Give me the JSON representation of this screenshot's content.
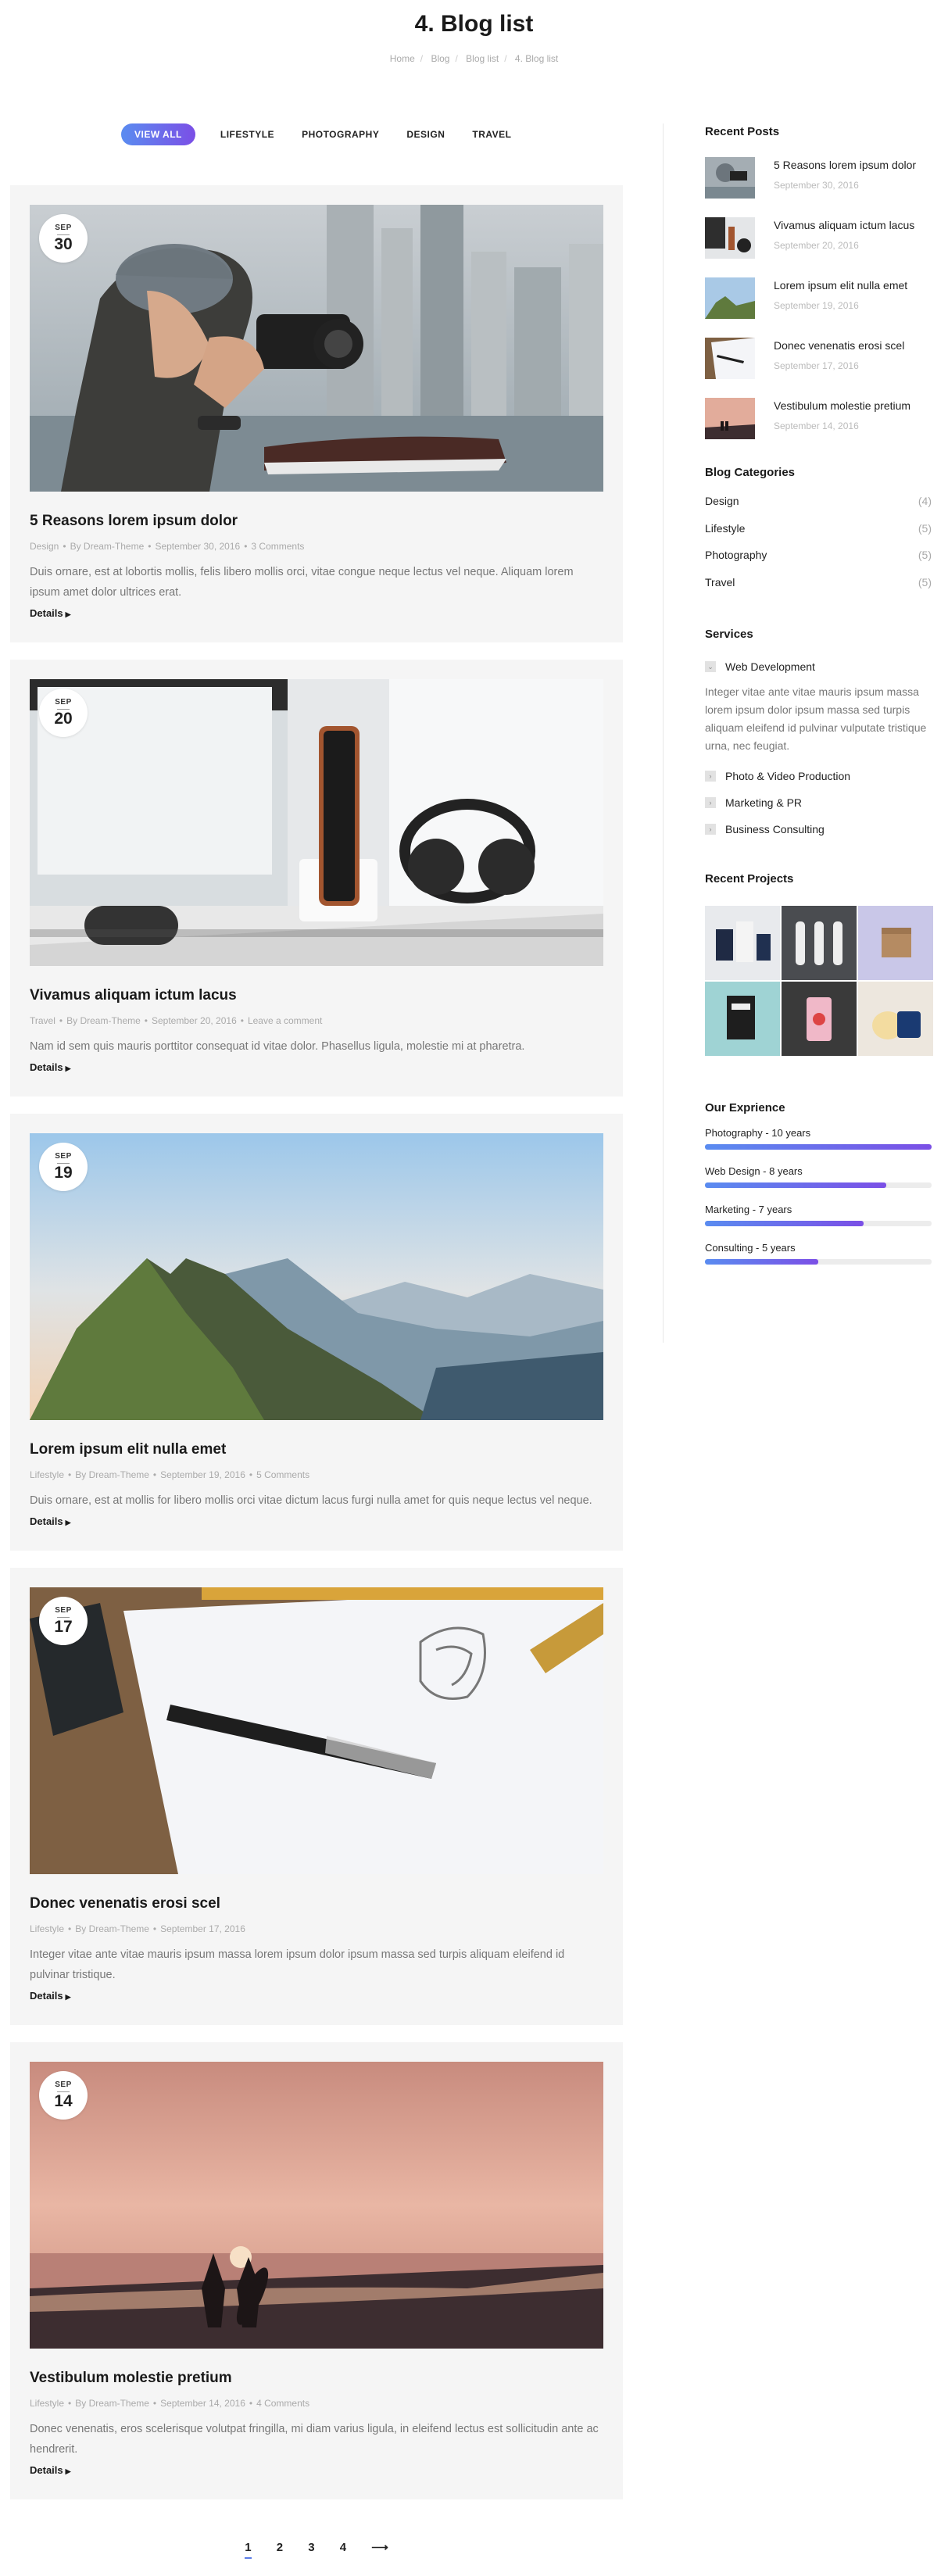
{
  "page": {
    "title": "4. Blog list",
    "breadcrumb": [
      "Home",
      "Blog",
      "Blog list",
      "4. Blog list"
    ]
  },
  "filters": [
    "VIEW ALL",
    "LIFESTYLE",
    "PHOTOGRAPHY",
    "DESIGN",
    "TRAVEL"
  ],
  "active_filter": "VIEW ALL",
  "posts": [
    {
      "month": "SEP",
      "day": "30",
      "title": "5 Reasons lorem ipsum dolor",
      "category": "Design",
      "author": "By Dream-Theme",
      "date": "September 30, 2016",
      "comments": "3 Comments",
      "excerpt": "Duis ornare, est at lobortis mollis, felis libero mollis orci, vitae congue neque lectus vel neque. Aliquam lorem ipsum amet dolor ultrices erat.",
      "details": "Details",
      "image": "photographer-icon"
    },
    {
      "month": "SEP",
      "day": "20",
      "title": "Vivamus aliquam ictum lacus",
      "category": "Travel",
      "author": "By Dream-Theme",
      "date": "September 20, 2016",
      "comments": "Leave a comment",
      "excerpt": "Nam id sem quis mauris porttitor consequat id vitae dolor. Phasellus ligula, molestie mi at pharetra.",
      "details": "Details",
      "image": "phone-headphones-icon"
    },
    {
      "month": "SEP",
      "day": "19",
      "title": "Lorem ipsum elit nulla emet",
      "category": "Lifestyle",
      "author": "By Dream-Theme",
      "date": "September 19, 2016",
      "comments": "5 Comments",
      "excerpt": "Duis ornare, est at mollis for libero mollis orci vitae dictum lacus furgi nulla amet for quis neque lectus vel neque.",
      "details": "Details",
      "image": "mountains-icon"
    },
    {
      "month": "SEP",
      "day": "17",
      "title": "Donec venenatis erosi scel",
      "category": "Lifestyle",
      "author": "By Dream-Theme",
      "date": "September 17, 2016",
      "comments": "",
      "excerpt": "Integer vitae ante vitae mauris ipsum massa lorem ipsum dolor ipsum massa sed turpis aliquam eleifend id pulvinar tristique.",
      "details": "Details",
      "image": "pen-sketch-icon"
    },
    {
      "month": "SEP",
      "day": "14",
      "title": "Vestibulum molestie pretium",
      "category": "Lifestyle",
      "author": "By Dream-Theme",
      "date": "September 14, 2016",
      "comments": "4 Comments",
      "excerpt": "Donec venenatis, eros scelerisque volutpat fringilla, mi diam varius ligula, in eleifend lectus est sollicitudin ante ac hendrerit.",
      "details": "Details",
      "image": "beach-sunset-icon"
    }
  ],
  "pagination": [
    "1",
    "2",
    "3",
    "4",
    "⟶"
  ],
  "sidebar": {
    "recent_title": "Recent Posts",
    "recent": [
      {
        "title": "5 Reasons lorem ipsum dolor",
        "date": "September 30, 2016"
      },
      {
        "title": "Vivamus aliquam ictum lacus",
        "date": "September 20, 2016"
      },
      {
        "title": "Lorem ipsum elit nulla emet",
        "date": "September 19, 2016"
      },
      {
        "title": "Donec venenatis erosi scel",
        "date": "September 17, 2016"
      },
      {
        "title": "Vestibulum molestie pretium",
        "date": "September 14, 2016"
      }
    ],
    "categories_title": "Blog Categories",
    "categories": [
      {
        "name": "Design",
        "count": "(4)"
      },
      {
        "name": "Lifestyle",
        "count": "(5)"
      },
      {
        "name": "Photography",
        "count": "(5)"
      },
      {
        "name": "Travel",
        "count": "(5)"
      }
    ],
    "services_title": "Services",
    "services": [
      "Web Development",
      "Photo & Video Production",
      "Marketing & PR",
      "Business Consulting"
    ],
    "service_desc": "Integer vitae ante vitae mauris ipsum massa lorem ipsum dolor ipsum massa sed turpis aliquam eleifend id pulvinar vulputate tristique urna, nec feugiat.",
    "projects_title": "Recent Projects",
    "experience_title": "Our Exprience",
    "skills": [
      {
        "label": "Photography - 10 years",
        "percent": 100
      },
      {
        "label": "Web Design - 8 years",
        "percent": 80
      },
      {
        "label": "Marketing - 7 years",
        "percent": 70
      },
      {
        "label": "Consulting - 5 years",
        "percent": 50
      }
    ]
  }
}
